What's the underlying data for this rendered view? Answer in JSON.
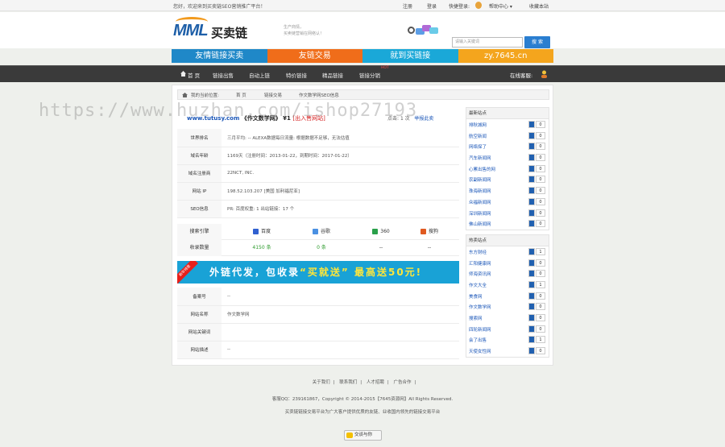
{
  "topbar": {
    "welcome": "您好，欢迎来到买卖链SEO营销推广平台！",
    "links": [
      "注册",
      "登录",
      "快捷登录:",
      "帮助中心 ▾",
      "收藏本站"
    ]
  },
  "header": {
    "logo_mark": "MML",
    "logo_text": "买卖链",
    "slogan_line1": "生产商情，",
    "slogan_line2": "买卖链营销在网络认！",
    "search_placeholder": "请输入关键词",
    "search_button": "搜 索"
  },
  "banners": [
    {
      "label": "友情链接买卖",
      "color": "#1f88c8"
    },
    {
      "label": "友链交易",
      "color": "#f06d1a"
    },
    {
      "label": "就到买链接",
      "color": "#1aa8d8"
    },
    {
      "label": "zy.7645.cn",
      "color": "#f4a51d"
    }
  ],
  "nav": {
    "items": [
      "首 页",
      "链接出售",
      "自动上链",
      "特价链接",
      "精品链接",
      "链接分销"
    ],
    "badge": "HOT",
    "guest": "在线客服:"
  },
  "breadcrumb": [
    "我的当前位置:",
    "首 页",
    "链接交易",
    "作文数学网SEO信息"
  ],
  "site": {
    "url": "www.tutusy.com",
    "name": "《作文数学网》",
    "price_prefix": "¥1",
    "contact": "[出入售网站]",
    "visits_label": "点击:",
    "visits": "1 次",
    "report": "举报此卖"
  },
  "info_rows": [
    {
      "label": "世界排名",
      "value": "三月平均:  --    ALEXA数据每日流量:  根据数据不足够，无法估值"
    },
    {
      "label": "域名年龄",
      "value": "1169天（注册时间：2013-01-22，到期时间：2017-01-22）"
    },
    {
      "label": "域名注册商",
      "value": "22NCT, INC."
    },
    {
      "label": "网站 IP",
      "value": "198.52.103.207    [美国 加利福尼亚]"
    },
    {
      "label": "SEO信息",
      "value": "PR:          百度权重:  1          出站链接：17 个"
    }
  ],
  "engines": {
    "header_label": "搜索引擎",
    "names": [
      "百度",
      "谷歌",
      "360",
      "搜狗"
    ],
    "colors": [
      "#3060d0",
      "#4a90e2",
      "#2aa04a",
      "#e05a20"
    ],
    "count_label": "收录数量",
    "counts": [
      "4150 条",
      "0 条",
      "--",
      "--"
    ]
  },
  "promo": {
    "corner": "新年特惠",
    "text_a": "外链代发，包收录",
    "text_b": "“买就送”",
    "text_c": "最高送50元!"
  },
  "info2_rows": [
    {
      "label": "备案号",
      "value": "--"
    },
    {
      "label": "网站名称",
      "value": "作文数学网"
    },
    {
      "label": "网站关键词",
      "value": ""
    },
    {
      "label": "网站描述",
      "value": "--"
    }
  ],
  "side_hot": {
    "title": "最新站点",
    "items": [
      {
        "name": "排秋城网",
        "count": "0"
      },
      {
        "name": "航空新闻",
        "count": "0"
      },
      {
        "name": "网络探了",
        "count": "0"
      },
      {
        "name": "汽车新闻网",
        "count": "0"
      },
      {
        "name": "心累出售的网",
        "count": "0"
      },
      {
        "name": "农副新闻网",
        "count": "0"
      },
      {
        "name": "珠海新闻网",
        "count": "0"
      },
      {
        "name": "众福新闻网",
        "count": "0"
      },
      {
        "name": "深圳新闻网",
        "count": "0"
      },
      {
        "name": "佛山新闻网",
        "count": "0"
      }
    ]
  },
  "side_rec": {
    "title": "热卖站点",
    "items": [
      {
        "name": "东方财经",
        "count": "1"
      },
      {
        "name": "汇阳健康网",
        "count": "0"
      },
      {
        "name": "师海资讯网",
        "count": "0"
      },
      {
        "name": "作文大全",
        "count": "1"
      },
      {
        "name": "美食网",
        "count": "0"
      },
      {
        "name": "作文数学网",
        "count": "0"
      },
      {
        "name": "搜索网",
        "count": "0"
      },
      {
        "name": "四轮新闻网",
        "count": "0"
      },
      {
        "name": "会了出售",
        "count": "1"
      },
      {
        "name": "天使女性网",
        "count": "0"
      }
    ]
  },
  "footer": {
    "links": [
      "关于我们",
      "联系我们",
      "人才招聘",
      "广告合作"
    ],
    "copyright": "客服QQ：239161867，Copyright © 2014-2015【7645资源网】All Rights Reserved.",
    "desc": "买卖链链接交易平台为广大客户提供优质的友链、业收国内领先的链接交易平台",
    "qq_button": "交谈与你"
  },
  "watermark": "https://www.huzhan.com/ishop27193"
}
